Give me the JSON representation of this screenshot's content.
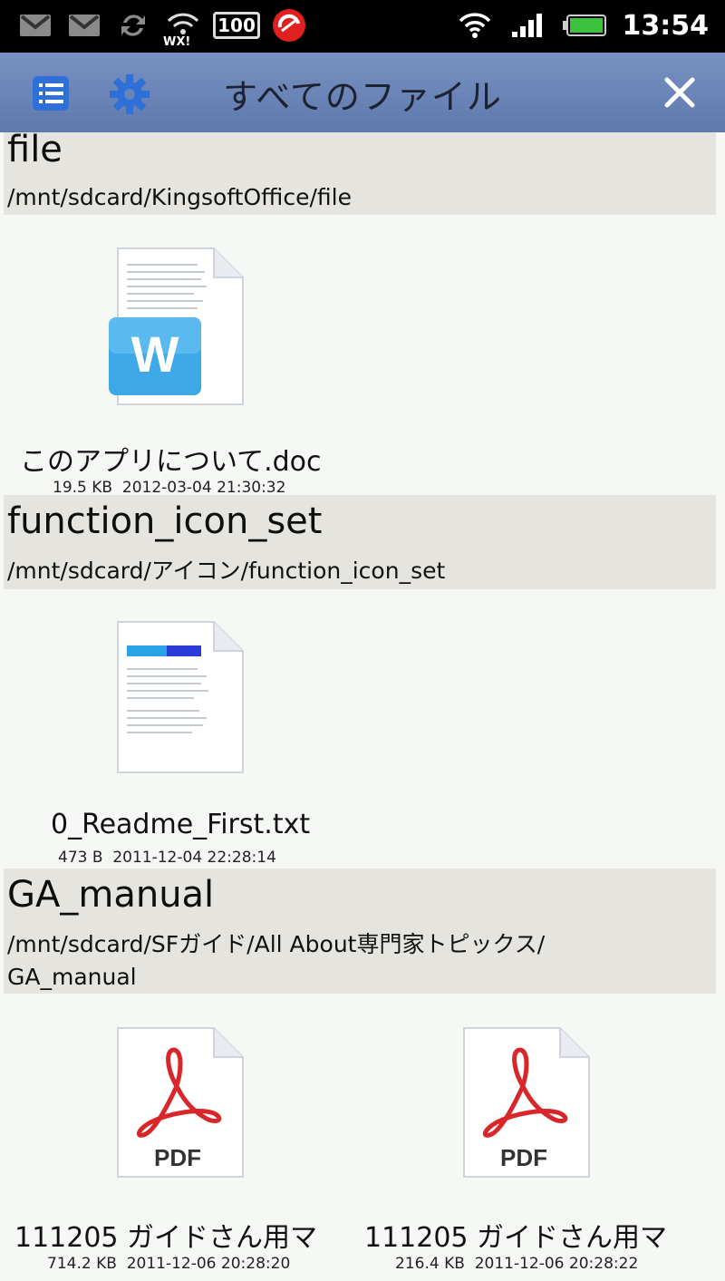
{
  "status_bar": {
    "time": "13:54",
    "icons": [
      "gmail-icon",
      "gmail-icon",
      "sync-icon",
      "wifi-wx-icon",
      "battery-100-badge-icon",
      "trendmicro-icon",
      "wifi-icon",
      "signal-icon",
      "battery-icon"
    ],
    "badge_100": "100",
    "wx_text": "WX!"
  },
  "header": {
    "title": "すべてのファイル",
    "left_icons": [
      "list-icon",
      "gear-icon"
    ],
    "right_icon": "close-icon",
    "colors": {
      "bar": "#6a83b8",
      "icon_blue": "#2f6fd8"
    }
  },
  "groups": [
    {
      "name": "file",
      "path": "/mnt/sdcard/KingsoftOffice/file",
      "files": [
        {
          "name": "このアプリについて.doc",
          "size": "19.5 KB",
          "date": "2012-03-04 21:30:32",
          "type": "word-doc-icon"
        }
      ]
    },
    {
      "name": "function_icon_set",
      "path": "/mnt/sdcard/アイコン/function_icon_set",
      "files": [
        {
          "name": "0_Readme_First.txt",
          "size": "473 B",
          "date": "2011-12-04 22:28:14",
          "type": "text-file-icon"
        }
      ]
    },
    {
      "name": "GA_manual",
      "path_line1": "/mnt/sdcard/SFガイド/All About専門家トピックス/",
      "path_line2": "GA_manual",
      "files": [
        {
          "name": "111205 ガイドさん用マ",
          "size": "714.2 KB",
          "date": "2011-12-06 20:28:20",
          "type": "pdf-file-icon",
          "label": "PDF"
        },
        {
          "name": "111205 ガイドさん用マ",
          "size": "216.4 KB",
          "date": "2011-12-06 20:28:22",
          "type": "pdf-file-icon",
          "label": "PDF"
        }
      ]
    }
  ]
}
